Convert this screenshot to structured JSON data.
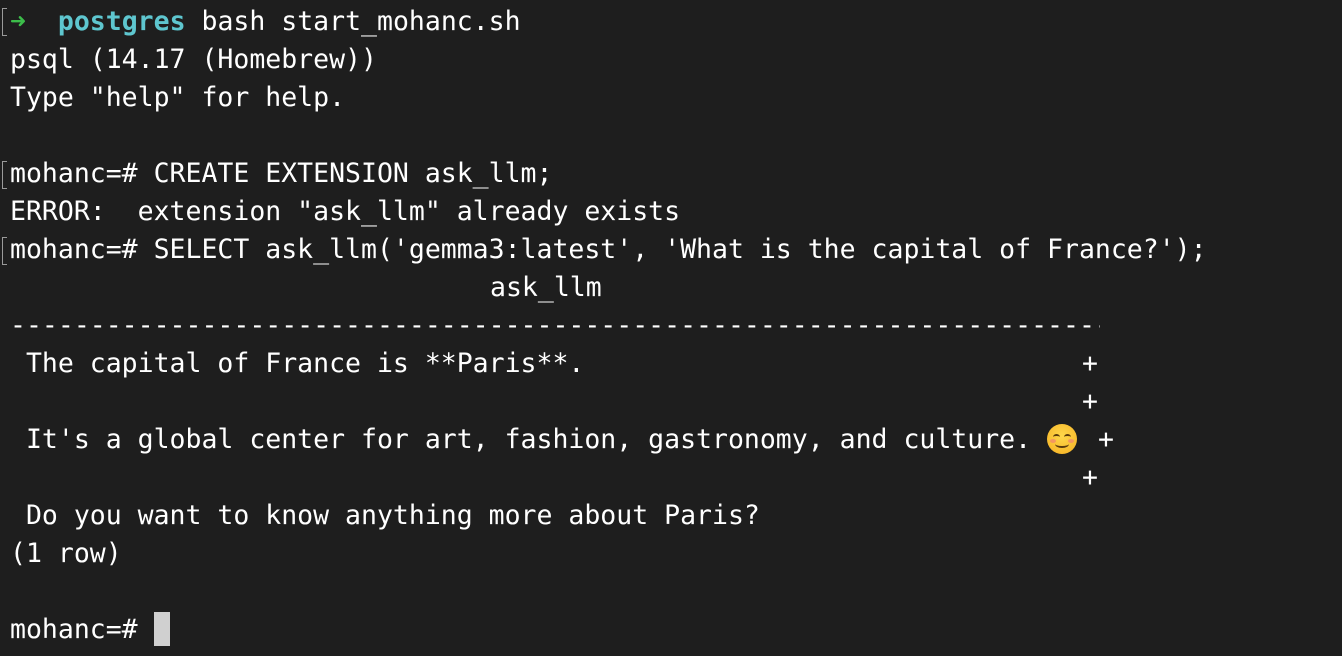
{
  "shell_prompt": {
    "arrow": "➜",
    "cwd": "postgres",
    "command": "bash start_mohanc.sh"
  },
  "lines": {
    "psql_version": "psql (14.17 (Homebrew))",
    "help_hint": "Type \"help\" for help.",
    "cmd1": "mohanc=# CREATE EXTENSION ask_llm;",
    "error": "ERROR:  extension \"ask_llm\" already exists",
    "cmd2": "mohanc=# SELECT ask_llm('gemma3:latest', 'What is the capital of France?');",
    "column_header": "ask_llm",
    "separator": "---------------------------------------------------------------------",
    "result_1": " The capital of France is **Paris**.",
    "result_2": " It's a global center for art, fashion, gastronomy, and culture.",
    "result_3": " Do you want to know anything more about Paris?",
    "row_count": "(1 row)",
    "final_prompt": "mohanc=# "
  },
  "continuation_marker": "+",
  "emoji": "smiling-face-icon",
  "colors": {
    "background": "#1e1e1e",
    "text": "#ffffff",
    "arrow": "#3cbd4a",
    "cwd": "#5ec6cf",
    "cursor": "#d0d0d0"
  }
}
